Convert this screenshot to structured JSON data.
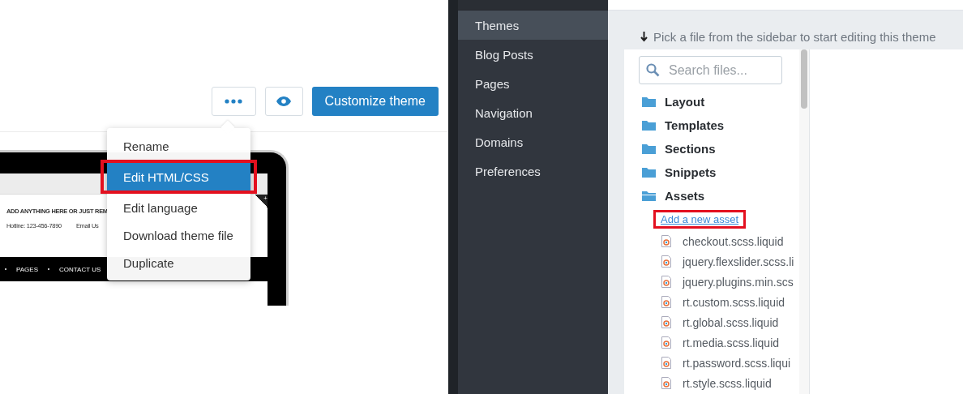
{
  "toolbar": {
    "buttons": [
      {
        "kind": "more"
      },
      {
        "kind": "preview"
      },
      {
        "kind": "primary",
        "label": "Customize theme"
      }
    ]
  },
  "preview": {
    "announcement": "ADD ANYTHING HERE OR JUST REM",
    "hotline": "Hotline: 123-456-7890",
    "email": "Email Us",
    "corner": "+",
    "nav": [
      "PAGES",
      "CONTACT US"
    ]
  },
  "menu": [
    {
      "label": "Rename",
      "selected": false,
      "annotated": false
    },
    {
      "label": "Edit HTML/CSS",
      "selected": true,
      "annotated": true
    },
    {
      "label": "Edit language",
      "selected": false,
      "annotated": false
    },
    {
      "label": "Download theme file",
      "selected": false,
      "annotated": false
    },
    {
      "label": "Duplicate",
      "selected": false,
      "annotated": false
    }
  ],
  "sidebar": {
    "items": [
      {
        "label": "Themes",
        "selected": true
      },
      {
        "label": "Blog Posts",
        "selected": false
      },
      {
        "label": "Pages",
        "selected": false
      },
      {
        "label": "Navigation",
        "selected": false
      },
      {
        "label": "Domains",
        "selected": false
      },
      {
        "label": "Preferences",
        "selected": false
      }
    ]
  },
  "hint": "Pick a file from the sidebar to start editing this theme",
  "search": {
    "placeholder": "Search files..."
  },
  "tree": [
    {
      "label": "Layout",
      "expanded": false
    },
    {
      "label": "Templates",
      "expanded": false
    },
    {
      "label": "Sections",
      "expanded": false
    },
    {
      "label": "Snippets",
      "expanded": false
    },
    {
      "label": "Assets",
      "expanded": true,
      "add_link": {
        "label": "Add a new asset",
        "annotated": true
      },
      "children": [
        {
          "label": "checkout.scss.liquid"
        },
        {
          "label": "jquery.flexslider.scss.li"
        },
        {
          "label": "jquery.plugins.min.scs"
        },
        {
          "label": "rt.custom.scss.liquid"
        },
        {
          "label": "rt.global.scss.liquid"
        },
        {
          "label": "rt.media.scss.liquid"
        },
        {
          "label": "rt.password.scss.liqui"
        },
        {
          "label": "rt.style.scss.liquid"
        }
      ]
    }
  ]
}
